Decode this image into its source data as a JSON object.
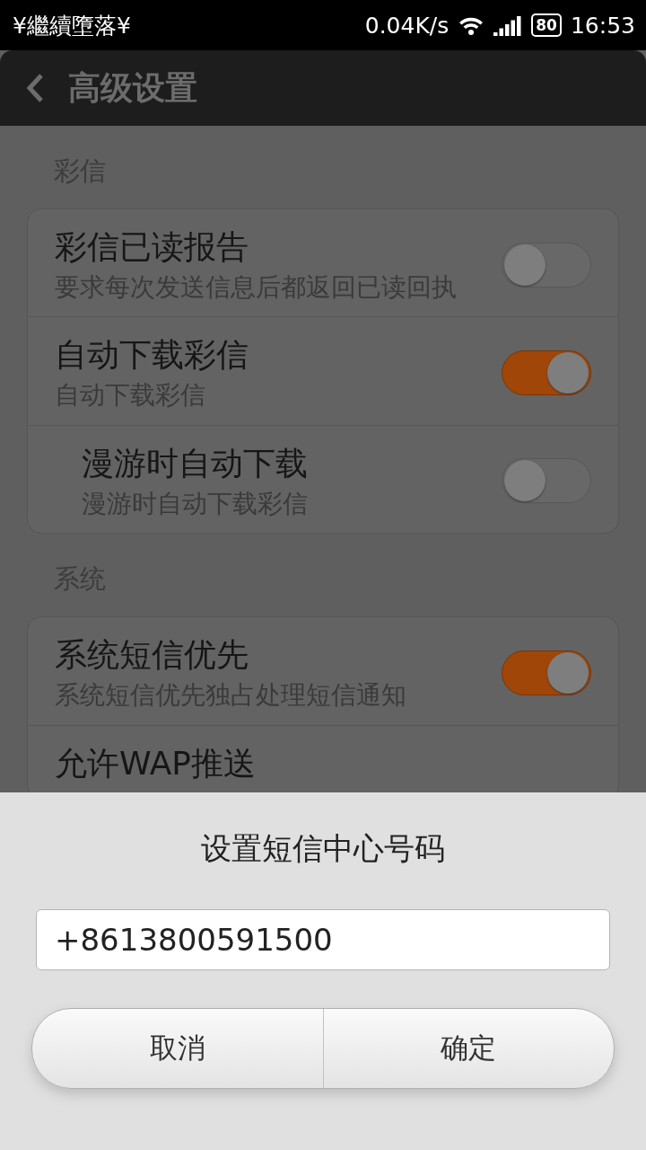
{
  "status_bar": {
    "carrier": "¥繼續墮落¥",
    "speed": "0.04K/s",
    "battery": "80",
    "time": "16:53"
  },
  "header": {
    "title": "高级设置"
  },
  "sections": [
    {
      "title": "彩信",
      "items": [
        {
          "title": "彩信已读报告",
          "subtitle": "要求每次发送信息后都返回已读回执",
          "on": false
        },
        {
          "title": "自动下载彩信",
          "subtitle": "自动下载彩信",
          "on": true,
          "children": [
            {
              "title": "漫游时自动下载",
              "subtitle": "漫游时自动下载彩信",
              "on": false
            }
          ]
        }
      ]
    },
    {
      "title": "系统",
      "items": [
        {
          "title": "系统短信优先",
          "subtitle": "系统短信优先独占处理短信通知",
          "on": true
        },
        {
          "title": "允许WAP推送"
        }
      ]
    }
  ],
  "dialog": {
    "title": "设置短信中心号码",
    "value": "+8613800591500",
    "buttons": [
      "取消",
      "确定"
    ]
  }
}
